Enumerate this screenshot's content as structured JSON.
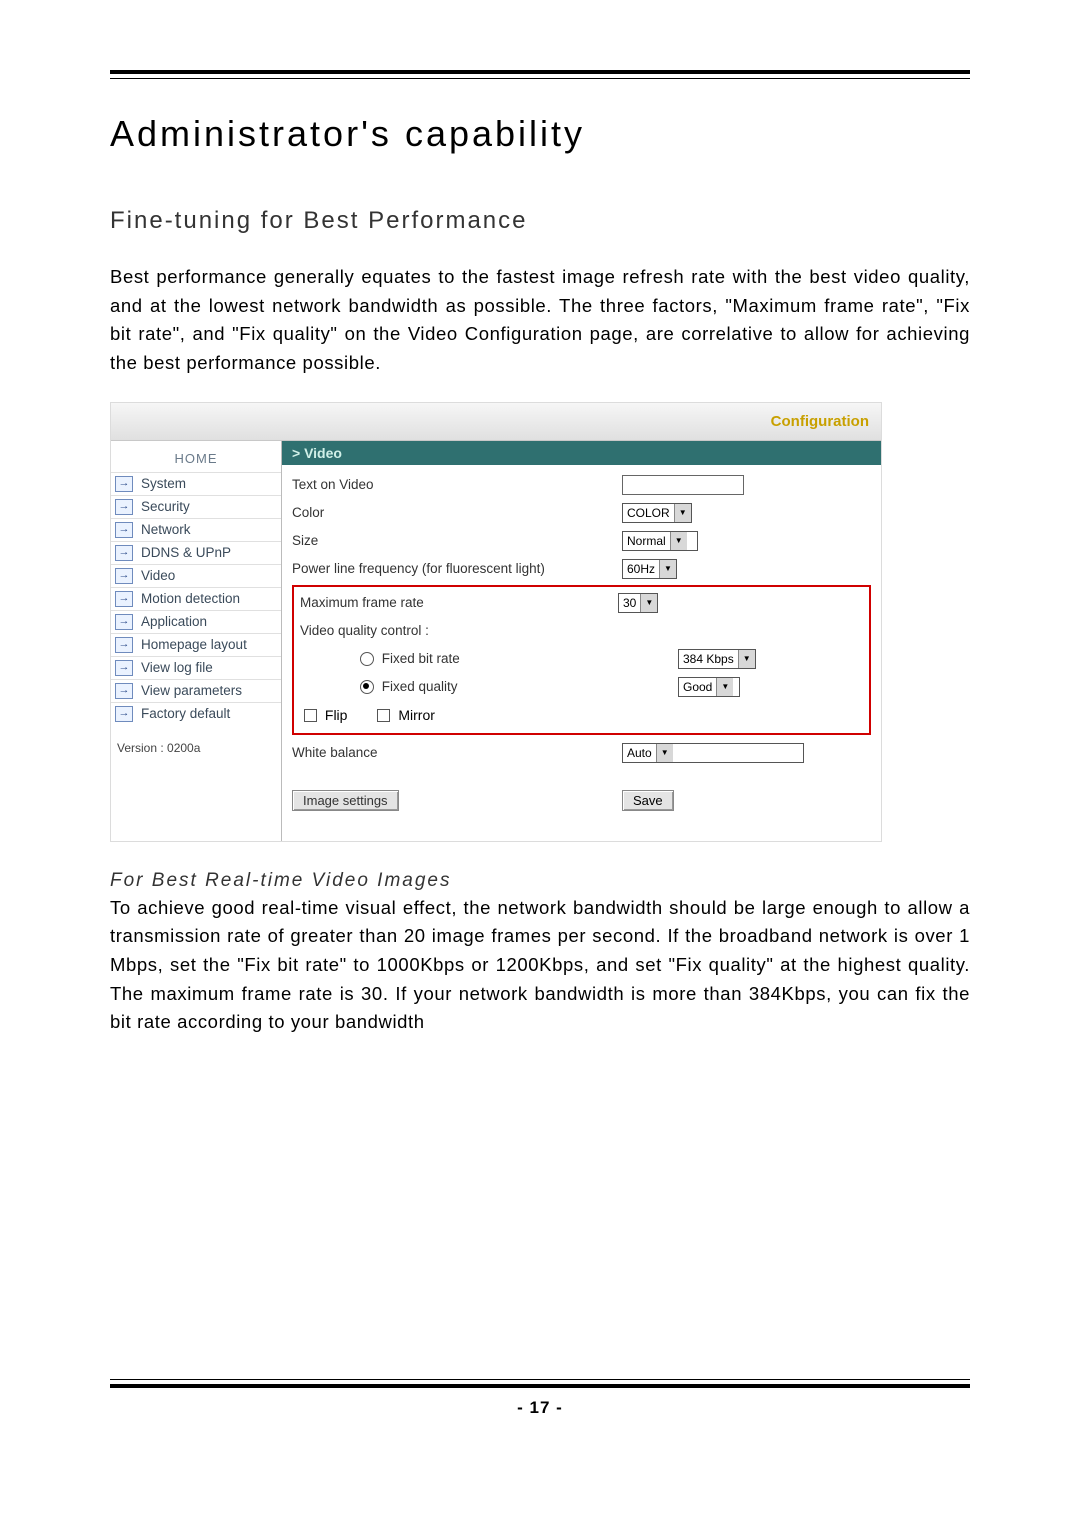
{
  "title": "Administrator's capability",
  "subtitle": "Fine-tuning for Best Performance",
  "paragraph1": "Best performance generally equates to the fastest image refresh rate with the best video quality, and at the lowest network bandwidth as possible. The three factors, \"Maximum frame rate\", \"Fix bit rate\", and \"Fix quality\" on the Video Configuration page, are correlative to allow for achieving the best performance possible.",
  "screenshot": {
    "header_label": "Configuration",
    "sidebar": {
      "home": "HOME",
      "items": [
        "System",
        "Security",
        "Network",
        "DDNS & UPnP",
        "Video",
        "Motion detection",
        "Application",
        "Homepage layout",
        "View log file",
        "View parameters",
        "Factory default"
      ],
      "version_text": "Version : 0200a"
    },
    "content": {
      "banner": "> Video",
      "text_on_video_label": "Text on Video",
      "text_on_video_value": "",
      "color_label": "Color",
      "color_value": "COLOR",
      "size_label": "Size",
      "size_value": "Normal",
      "freq_label": "Power line frequency (for fluorescent light)",
      "freq_value": "60Hz",
      "max_frame_label": "Maximum frame rate",
      "max_frame_value": "30",
      "vqc_label": "Video quality control :",
      "fixed_bitrate_label": "Fixed bit rate",
      "fixed_bitrate_value": "384 Kbps",
      "fixed_quality_label": "Fixed quality",
      "fixed_quality_value": "Good",
      "flip_label": "Flip",
      "mirror_label": "Mirror",
      "wb_label": "White balance",
      "wb_value": "Auto",
      "image_settings_btn": "Image settings",
      "save_btn": "Save"
    }
  },
  "realtime_head": "For Best Real-time Video Images",
  "paragraph2": "To achieve good real-time visual effect, the network bandwidth should be large enough to allow a transmission rate of greater than 20 image frames per second. If the broadband network is over 1 Mbps, set the \"Fix bit rate\" to 1000Kbps or 1200Kbps, and set \"Fix quality\" at the highest quality. The maximum frame rate is 30. If your network bandwidth is more than 384Kbps, you can fix the bit rate according to your bandwidth",
  "page_number": "- 17 -"
}
